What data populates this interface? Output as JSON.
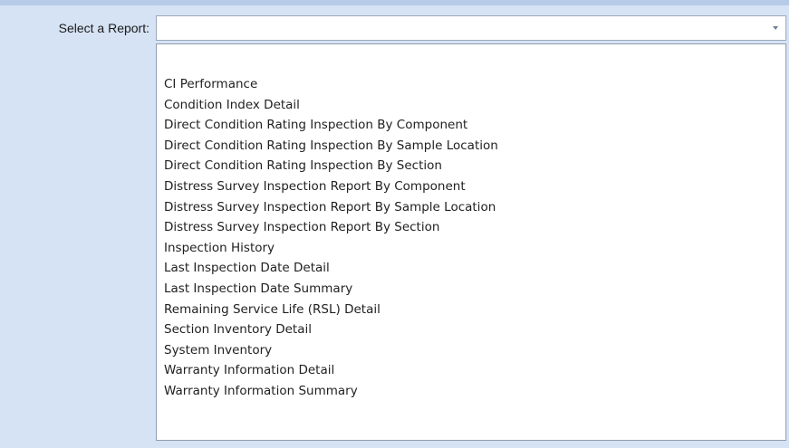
{
  "report_selector": {
    "label": "Select a Report:",
    "value": "",
    "options": [
      "CI Performance",
      "Condition Index Detail",
      "Direct Condition Rating Inspection By Component",
      "Direct Condition Rating Inspection By Sample Location",
      "Direct Condition Rating Inspection By Section",
      "Distress Survey Inspection Report By Component",
      "Distress Survey Inspection Report By Sample Location",
      "Distress Survey Inspection Report By Section",
      "Inspection History",
      "Last Inspection Date Detail",
      "Last Inspection Date Summary",
      "Remaining Service Life (RSL) Detail",
      "Section Inventory Detail",
      "System Inventory",
      "Warranty Information Detail",
      "Warranty Information Summary"
    ]
  },
  "icons": {
    "dropdown_arrow": "chevron-down-icon"
  }
}
